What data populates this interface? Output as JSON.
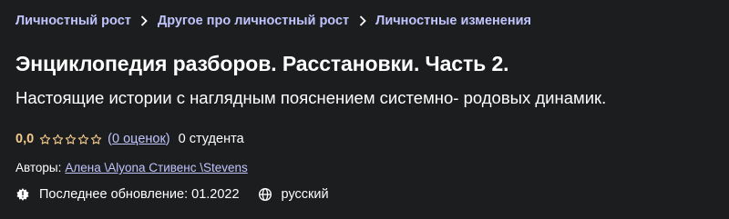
{
  "breadcrumb": {
    "items": [
      {
        "label": "Личностный рост"
      },
      {
        "label": "Другое про личностный рост"
      },
      {
        "label": "Личностные изменения"
      }
    ]
  },
  "course": {
    "title": "Энциклопедия разборов. Расстановки. Часть 2.",
    "subtitle": "Настоящие истории с наглядным пояснением системно- родовых динамик."
  },
  "rating": {
    "value": "0,0",
    "stars": 0,
    "open_paren": "(",
    "count_label": "0 оценок",
    "close_paren": ")",
    "students": "0 студента"
  },
  "authors": {
    "label": "Авторы:",
    "names": "Алена \\Alyona Стивенс \\Stevens"
  },
  "meta": {
    "updated": "Последнее обновление: 01.2022",
    "language": "русский"
  },
  "colors": {
    "background": "#1c1d1f",
    "link": "#c0c4fc",
    "rating": "#f3ca8c",
    "text": "#ffffff"
  },
  "icons": {
    "separator": "chevron-right-icon",
    "star": "star-outline-icon",
    "updated": "update-alert-icon",
    "language": "globe-icon"
  }
}
